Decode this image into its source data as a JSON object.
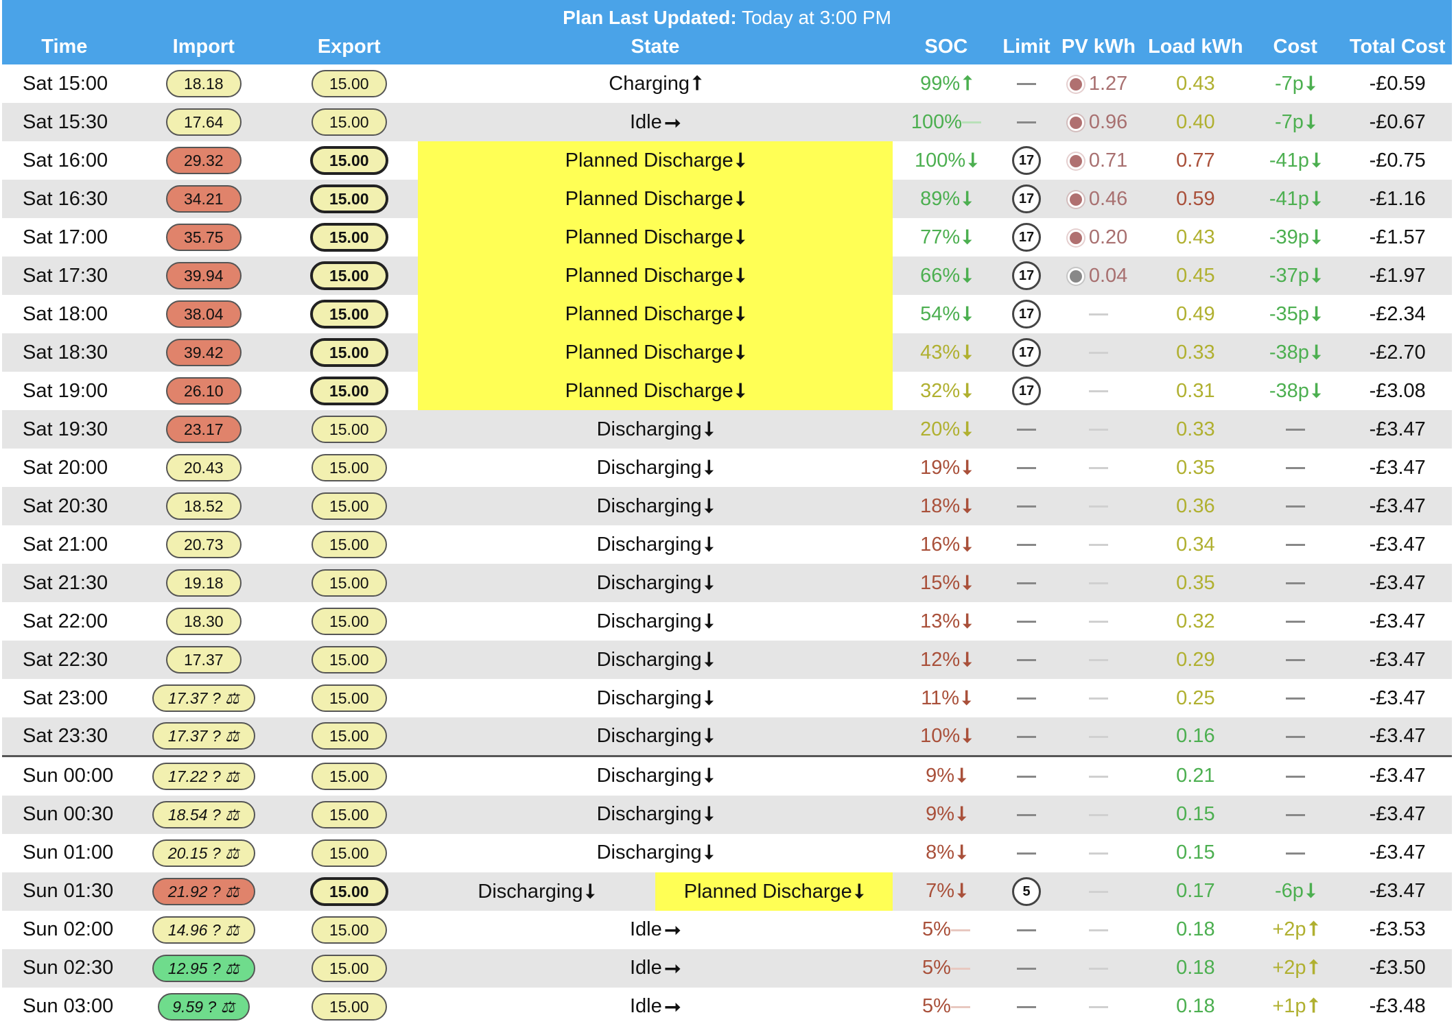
{
  "banner": {
    "label": "Plan Last Updated:",
    "value": "Today at 3:00 PM"
  },
  "columns": [
    "Time",
    "Import",
    "Export",
    "State",
    "SOC",
    "Limit",
    "PV kWh",
    "Load kWh",
    "Cost",
    "Total Cost"
  ],
  "colors": {
    "header_bg": "#4aa3e8",
    "planned_highlight": "#ffff55",
    "pill_yellow": "#f2f0b0",
    "pill_red": "#e0836b",
    "pill_green": "#6fdc8c",
    "text_green": "#4caf50",
    "text_olive": "#b0b030",
    "text_red": "#a9503a"
  },
  "rows": [
    {
      "time": "Sat 15:00",
      "import": "18.18",
      "import_color": "yellow",
      "export": "15.00",
      "export_bold": false,
      "state": "Charging",
      "state_dir": "up",
      "state_hl": false,
      "soc": "99%",
      "soc_dir": "up",
      "soc_color": "green",
      "limit": "",
      "pv": "1.27",
      "pv_sun": "#b07070",
      "load": "0.43",
      "load_color": "olive",
      "cost": "-7p",
      "cost_dir": "down",
      "cost_color": "green",
      "total": "-£0.59"
    },
    {
      "time": "Sat 15:30",
      "import": "17.64",
      "import_color": "yellow",
      "export": "15.00",
      "export_bold": false,
      "state": "Idle",
      "state_dir": "right",
      "state_hl": false,
      "soc": "100%",
      "soc_dir": "flat",
      "soc_color": "green",
      "limit": "",
      "pv": "0.96",
      "pv_sun": "#b07070",
      "load": "0.40",
      "load_color": "olive",
      "cost": "-7p",
      "cost_dir": "down",
      "cost_color": "green",
      "total": "-£0.67"
    },
    {
      "time": "Sat 16:00",
      "import": "29.32",
      "import_color": "red",
      "export": "15.00",
      "export_bold": true,
      "state": "Planned Discharge",
      "state_dir": "down",
      "state_hl": true,
      "soc": "100%",
      "soc_dir": "down",
      "soc_color": "green",
      "limit": "17",
      "pv": "0.71",
      "pv_sun": "#b07070",
      "load": "0.77",
      "load_color": "red",
      "cost": "-41p",
      "cost_dir": "down",
      "cost_color": "green",
      "total": "-£0.75"
    },
    {
      "time": "Sat 16:30",
      "import": "34.21",
      "import_color": "red",
      "export": "15.00",
      "export_bold": true,
      "state": "Planned Discharge",
      "state_dir": "down",
      "state_hl": true,
      "soc": "89%",
      "soc_dir": "down",
      "soc_color": "green",
      "limit": "17",
      "pv": "0.46",
      "pv_sun": "#b07070",
      "load": "0.59",
      "load_color": "red",
      "cost": "-41p",
      "cost_dir": "down",
      "cost_color": "green",
      "total": "-£1.16"
    },
    {
      "time": "Sat 17:00",
      "import": "35.75",
      "import_color": "red",
      "export": "15.00",
      "export_bold": true,
      "state": "Planned Discharge",
      "state_dir": "down",
      "state_hl": true,
      "soc": "77%",
      "soc_dir": "down",
      "soc_color": "green",
      "limit": "17",
      "pv": "0.20",
      "pv_sun": "#b07070",
      "load": "0.43",
      "load_color": "olive",
      "cost": "-39p",
      "cost_dir": "down",
      "cost_color": "green",
      "total": "-£1.57"
    },
    {
      "time": "Sat 17:30",
      "import": "39.94",
      "import_color": "red",
      "export": "15.00",
      "export_bold": true,
      "state": "Planned Discharge",
      "state_dir": "down",
      "state_hl": true,
      "soc": "66%",
      "soc_dir": "down",
      "soc_color": "green",
      "limit": "17",
      "pv": "0.04",
      "pv_sun": "#888888",
      "load": "0.45",
      "load_color": "olive",
      "cost": "-37p",
      "cost_dir": "down",
      "cost_color": "green",
      "total": "-£1.97"
    },
    {
      "time": "Sat 18:00",
      "import": "38.04",
      "import_color": "red",
      "export": "15.00",
      "export_bold": true,
      "state": "Planned Discharge",
      "state_dir": "down",
      "state_hl": true,
      "soc": "54%",
      "soc_dir": "down",
      "soc_color": "green",
      "limit": "17",
      "pv": "",
      "pv_sun": "",
      "load": "0.49",
      "load_color": "olive",
      "cost": "-35p",
      "cost_dir": "down",
      "cost_color": "green",
      "total": "-£2.34"
    },
    {
      "time": "Sat 18:30",
      "import": "39.42",
      "import_color": "red",
      "export": "15.00",
      "export_bold": true,
      "state": "Planned Discharge",
      "state_dir": "down",
      "state_hl": true,
      "soc": "43%",
      "soc_dir": "down",
      "soc_color": "olive",
      "limit": "17",
      "pv": "",
      "pv_sun": "",
      "load": "0.33",
      "load_color": "olive",
      "cost": "-38p",
      "cost_dir": "down",
      "cost_color": "green",
      "total": "-£2.70"
    },
    {
      "time": "Sat 19:00",
      "import": "26.10",
      "import_color": "red",
      "export": "15.00",
      "export_bold": true,
      "state": "Planned Discharge",
      "state_dir": "down",
      "state_hl": true,
      "soc": "32%",
      "soc_dir": "down",
      "soc_color": "olive",
      "limit": "17",
      "pv": "",
      "pv_sun": "",
      "load": "0.31",
      "load_color": "olive",
      "cost": "-38p",
      "cost_dir": "down",
      "cost_color": "green",
      "total": "-£3.08"
    },
    {
      "time": "Sat 19:30",
      "import": "23.17",
      "import_color": "red",
      "export": "15.00",
      "export_bold": false,
      "state": "Discharging",
      "state_dir": "down",
      "state_hl": false,
      "soc": "20%",
      "soc_dir": "down",
      "soc_color": "olive",
      "limit": "",
      "pv": "",
      "pv_sun": "",
      "load": "0.33",
      "load_color": "olive",
      "cost": "",
      "cost_dir": "",
      "cost_color": "",
      "total": "-£3.47"
    },
    {
      "time": "Sat 20:00",
      "import": "20.43",
      "import_color": "yellow",
      "export": "15.00",
      "export_bold": false,
      "state": "Discharging",
      "state_dir": "down",
      "state_hl": false,
      "soc": "19%",
      "soc_dir": "down",
      "soc_color": "red",
      "limit": "",
      "pv": "",
      "pv_sun": "",
      "load": "0.35",
      "load_color": "olive",
      "cost": "",
      "cost_dir": "",
      "cost_color": "",
      "total": "-£3.47"
    },
    {
      "time": "Sat 20:30",
      "import": "18.52",
      "import_color": "yellow",
      "export": "15.00",
      "export_bold": false,
      "state": "Discharging",
      "state_dir": "down",
      "state_hl": false,
      "soc": "18%",
      "soc_dir": "down",
      "soc_color": "red",
      "limit": "",
      "pv": "",
      "pv_sun": "",
      "load": "0.36",
      "load_color": "olive",
      "cost": "",
      "cost_dir": "",
      "cost_color": "",
      "total": "-£3.47"
    },
    {
      "time": "Sat 21:00",
      "import": "20.73",
      "import_color": "yellow",
      "export": "15.00",
      "export_bold": false,
      "state": "Discharging",
      "state_dir": "down",
      "state_hl": false,
      "soc": "16%",
      "soc_dir": "down",
      "soc_color": "red",
      "limit": "",
      "pv": "",
      "pv_sun": "",
      "load": "0.34",
      "load_color": "olive",
      "cost": "",
      "cost_dir": "",
      "cost_color": "",
      "total": "-£3.47"
    },
    {
      "time": "Sat 21:30",
      "import": "19.18",
      "import_color": "yellow",
      "export": "15.00",
      "export_bold": false,
      "state": "Discharging",
      "state_dir": "down",
      "state_hl": false,
      "soc": "15%",
      "soc_dir": "down",
      "soc_color": "red",
      "limit": "",
      "pv": "",
      "pv_sun": "",
      "load": "0.35",
      "load_color": "olive",
      "cost": "",
      "cost_dir": "",
      "cost_color": "",
      "total": "-£3.47"
    },
    {
      "time": "Sat 22:00",
      "import": "18.30",
      "import_color": "yellow",
      "export": "15.00",
      "export_bold": false,
      "state": "Discharging",
      "state_dir": "down",
      "state_hl": false,
      "soc": "13%",
      "soc_dir": "down",
      "soc_color": "red",
      "limit": "",
      "pv": "",
      "pv_sun": "",
      "load": "0.32",
      "load_color": "olive",
      "cost": "",
      "cost_dir": "",
      "cost_color": "",
      "total": "-£3.47"
    },
    {
      "time": "Sat 22:30",
      "import": "17.37",
      "import_color": "yellow",
      "export": "15.00",
      "export_bold": false,
      "state": "Discharging",
      "state_dir": "down",
      "state_hl": false,
      "soc": "12%",
      "soc_dir": "down",
      "soc_color": "red",
      "limit": "",
      "pv": "",
      "pv_sun": "",
      "load": "0.29",
      "load_color": "olive",
      "cost": "",
      "cost_dir": "",
      "cost_color": "",
      "total": "-£3.47"
    },
    {
      "time": "Sat 23:00",
      "import": "17.37 ? ⚖",
      "import_color": "yellow",
      "import_wide": true,
      "export": "15.00",
      "export_bold": false,
      "state": "Discharging",
      "state_dir": "down",
      "state_hl": false,
      "soc": "11%",
      "soc_dir": "down",
      "soc_color": "red",
      "limit": "",
      "pv": "",
      "pv_sun": "",
      "load": "0.25",
      "load_color": "olive",
      "cost": "",
      "cost_dir": "",
      "cost_color": "",
      "total": "-£3.47"
    },
    {
      "time": "Sat 23:30",
      "import": "17.37 ? ⚖",
      "import_color": "yellow",
      "import_wide": true,
      "export": "15.00",
      "export_bold": false,
      "state": "Discharging",
      "state_dir": "down",
      "state_hl": false,
      "soc": "10%",
      "soc_dir": "down",
      "soc_color": "red",
      "limit": "",
      "pv": "",
      "pv_sun": "",
      "load": "0.16",
      "load_color": "green",
      "cost": "",
      "cost_dir": "",
      "cost_color": "",
      "total": "-£3.47"
    },
    {
      "time": "Sun 00:00",
      "day_start": true,
      "import": "17.22 ? ⚖",
      "import_color": "yellow",
      "import_wide": true,
      "export": "15.00",
      "export_bold": false,
      "state": "Discharging",
      "state_dir": "down",
      "state_hl": false,
      "soc": "9%",
      "soc_dir": "down",
      "soc_color": "red",
      "limit": "",
      "pv": "",
      "pv_sun": "",
      "load": "0.21",
      "load_color": "green",
      "cost": "",
      "cost_dir": "",
      "cost_color": "",
      "total": "-£3.47"
    },
    {
      "time": "Sun 00:30",
      "import": "18.54 ? ⚖",
      "import_color": "yellow",
      "import_wide": true,
      "export": "15.00",
      "export_bold": false,
      "state": "Discharging",
      "state_dir": "down",
      "state_hl": false,
      "soc": "9%",
      "soc_dir": "down",
      "soc_color": "red",
      "limit": "",
      "pv": "",
      "pv_sun": "",
      "load": "0.15",
      "load_color": "green",
      "cost": "",
      "cost_dir": "",
      "cost_color": "",
      "total": "-£3.47"
    },
    {
      "time": "Sun 01:00",
      "import": "20.15 ? ⚖",
      "import_color": "yellow",
      "import_wide": true,
      "export": "15.00",
      "export_bold": false,
      "state": "Discharging",
      "state_dir": "down",
      "state_hl": false,
      "soc": "8%",
      "soc_dir": "down",
      "soc_color": "red",
      "limit": "",
      "pv": "",
      "pv_sun": "",
      "load": "0.15",
      "load_color": "green",
      "cost": "",
      "cost_dir": "",
      "cost_color": "",
      "total": "-£3.47"
    },
    {
      "time": "Sun 01:30",
      "import": "21.92 ? ⚖",
      "import_color": "red",
      "import_wide": true,
      "export": "15.00",
      "export_bold": true,
      "state": "Discharging",
      "state_dir": "down",
      "state_hl": false,
      "state_split": "Planned Discharge",
      "soc": "7%",
      "soc_dir": "down",
      "soc_color": "red",
      "limit": "5",
      "pv": "",
      "pv_sun": "",
      "load": "0.17",
      "load_color": "green",
      "cost": "-6p",
      "cost_dir": "down",
      "cost_color": "green",
      "total": "-£3.47"
    },
    {
      "time": "Sun 02:00",
      "import": "14.96 ? ⚖",
      "import_color": "yellow",
      "import_wide": true,
      "export": "15.00",
      "export_bold": false,
      "state": "Idle",
      "state_dir": "right",
      "state_hl": false,
      "soc": "5%",
      "soc_dir": "flat",
      "soc_color": "red",
      "limit": "",
      "pv": "",
      "pv_sun": "",
      "load": "0.18",
      "load_color": "green",
      "cost": "+2p",
      "cost_dir": "up",
      "cost_color": "olive",
      "total": "-£3.53"
    },
    {
      "time": "Sun 02:30",
      "import": "12.95 ? ⚖",
      "import_color": "green",
      "import_wide": true,
      "export": "15.00",
      "export_bold": false,
      "state": "Idle",
      "state_dir": "right",
      "state_hl": false,
      "soc": "5%",
      "soc_dir": "flat",
      "soc_color": "red",
      "limit": "",
      "pv": "",
      "pv_sun": "",
      "load": "0.18",
      "load_color": "green",
      "cost": "+2p",
      "cost_dir": "up",
      "cost_color": "olive",
      "total": "-£3.50"
    },
    {
      "time": "Sun 03:00",
      "import": "9.59 ? ⚖",
      "import_color": "green",
      "import_wide": true,
      "import_sm": true,
      "export": "15.00",
      "export_bold": false,
      "state": "Idle",
      "state_dir": "right",
      "state_hl": false,
      "soc": "5%",
      "soc_dir": "flat",
      "soc_color": "red",
      "limit": "",
      "pv": "",
      "pv_sun": "",
      "load": "0.18",
      "load_color": "green",
      "cost": "+1p",
      "cost_dir": "up",
      "cost_color": "olive",
      "total": "-£3.48"
    }
  ]
}
